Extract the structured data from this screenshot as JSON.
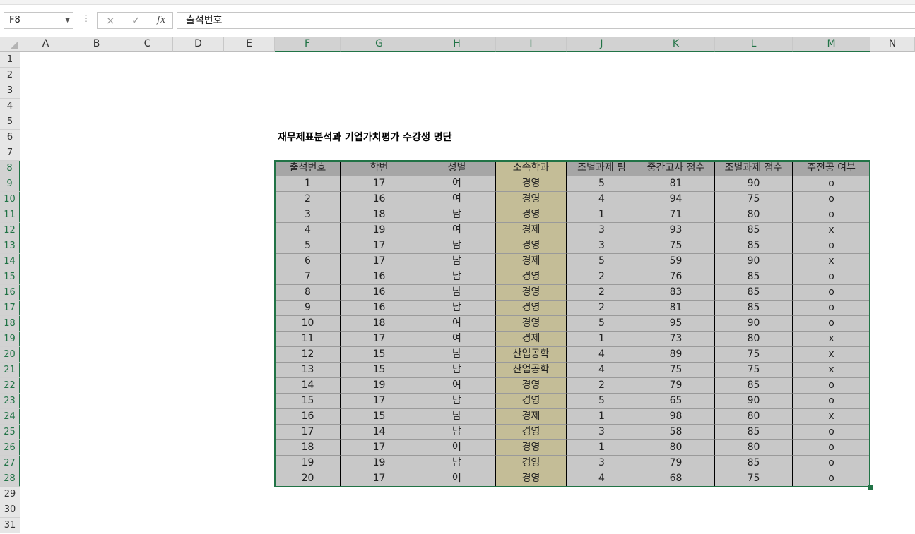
{
  "formula_bar": {
    "name_box": "F8",
    "cancel_icon": "×",
    "enter_icon": "✓",
    "fx_label": "fx",
    "formula": "출석번호"
  },
  "columns": [
    "A",
    "B",
    "C",
    "D",
    "E",
    "F",
    "G",
    "H",
    "I",
    "J",
    "K",
    "L",
    "M",
    "N"
  ],
  "rows": [
    "1",
    "2",
    "3",
    "4",
    "5",
    "6",
    "7",
    "8",
    "9",
    "10",
    "11",
    "12",
    "13",
    "14",
    "15",
    "16",
    "17",
    "18",
    "19",
    "20",
    "21",
    "22",
    "23",
    "24",
    "25",
    "26",
    "27",
    "28",
    "29",
    "30",
    "31"
  ],
  "sheet_title": "재무제표분석과 기업가치평가 수강생 명단",
  "table": {
    "headers": [
      "출석번호",
      "학번",
      "성별",
      "소속학과",
      "조별과제 팀",
      "중간고사 점수",
      "조별과제 점수",
      "주전공 여부"
    ],
    "rows": [
      [
        "1",
        "17",
        "여",
        "경영",
        "5",
        "81",
        "90",
        "o"
      ],
      [
        "2",
        "16",
        "여",
        "경영",
        "4",
        "94",
        "75",
        "o"
      ],
      [
        "3",
        "18",
        "남",
        "경영",
        "1",
        "71",
        "80",
        "o"
      ],
      [
        "4",
        "19",
        "여",
        "경제",
        "3",
        "93",
        "85",
        "x"
      ],
      [
        "5",
        "17",
        "남",
        "경영",
        "3",
        "75",
        "85",
        "o"
      ],
      [
        "6",
        "17",
        "남",
        "경제",
        "5",
        "59",
        "90",
        "x"
      ],
      [
        "7",
        "16",
        "남",
        "경영",
        "2",
        "76",
        "85",
        "o"
      ],
      [
        "8",
        "16",
        "남",
        "경영",
        "2",
        "83",
        "85",
        "o"
      ],
      [
        "9",
        "16",
        "남",
        "경영",
        "2",
        "81",
        "85",
        "o"
      ],
      [
        "10",
        "18",
        "여",
        "경영",
        "5",
        "95",
        "90",
        "o"
      ],
      [
        "11",
        "17",
        "여",
        "경제",
        "1",
        "73",
        "80",
        "x"
      ],
      [
        "12",
        "15",
        "남",
        "산업공학",
        "4",
        "89",
        "75",
        "x"
      ],
      [
        "13",
        "15",
        "남",
        "산업공학",
        "4",
        "75",
        "75",
        "x"
      ],
      [
        "14",
        "19",
        "여",
        "경영",
        "2",
        "79",
        "85",
        "o"
      ],
      [
        "15",
        "17",
        "남",
        "경영",
        "5",
        "65",
        "90",
        "o"
      ],
      [
        "16",
        "15",
        "남",
        "경제",
        "1",
        "98",
        "80",
        "x"
      ],
      [
        "17",
        "14",
        "남",
        "경영",
        "3",
        "58",
        "85",
        "o"
      ],
      [
        "18",
        "17",
        "여",
        "경영",
        "1",
        "80",
        "80",
        "o"
      ],
      [
        "19",
        "19",
        "남",
        "경영",
        "3",
        "79",
        "85",
        "o"
      ],
      [
        "20",
        "17",
        "여",
        "경영",
        "4",
        "68",
        "75",
        "o"
      ]
    ]
  },
  "colors": {
    "selection": "#217346",
    "table_fill": "#c8c8c8",
    "header_fill": "#a6a6a6",
    "dept_fill": "#c4bd97"
  }
}
